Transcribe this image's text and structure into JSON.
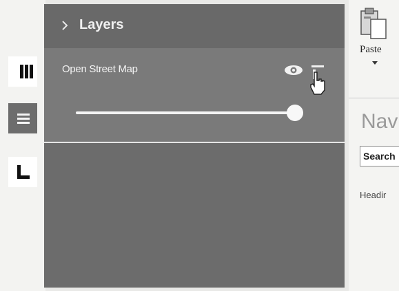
{
  "toolbar": {
    "items": [
      {
        "icon": "columns-icon",
        "active": false
      },
      {
        "icon": "list-icon",
        "active": true
      },
      {
        "icon": "corner-icon",
        "active": false
      }
    ]
  },
  "layers_panel": {
    "title": "Layers",
    "layers": [
      {
        "name": "Open Street Map",
        "visible": true,
        "opacity": 1.0
      }
    ]
  },
  "word_ribbon": {
    "paste_label": "Paste",
    "navigation_title": "Nav",
    "search_placeholder": "Search",
    "headings_tab": "Headir"
  },
  "colors": {
    "panel": "#6f6f6f",
    "panel_header": "#696969",
    "active_tool": "#6d6d6d"
  }
}
